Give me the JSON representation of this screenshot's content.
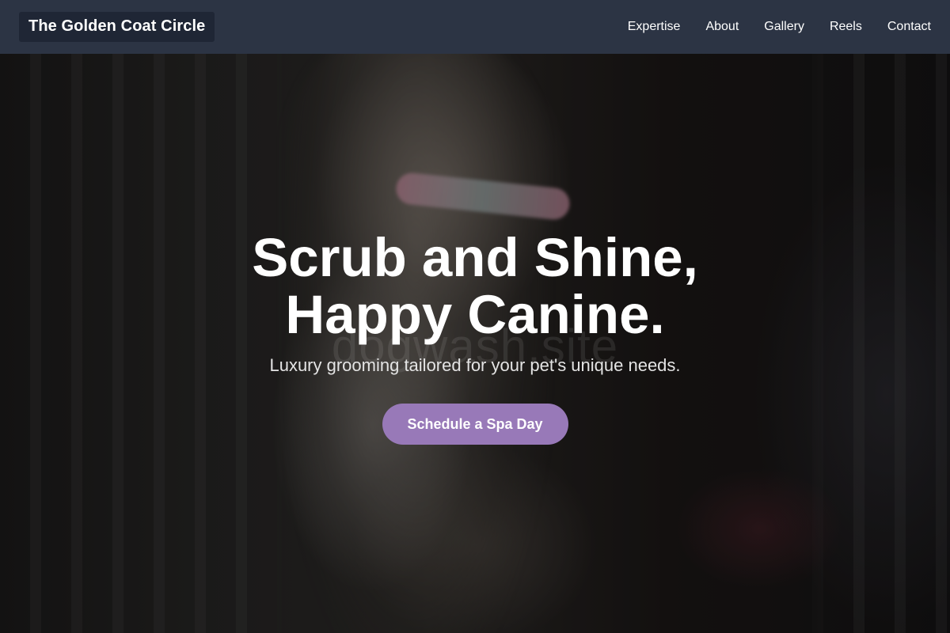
{
  "nav": {
    "brand": "The Golden Coat Circle",
    "links": [
      "Expertise",
      "About",
      "Gallery",
      "Reels",
      "Contact"
    ]
  },
  "hero": {
    "title_line1": "Scrub and Shine,",
    "title_line2": "Happy Canine.",
    "subtitle": "Luxury grooming tailored for your pet's unique needs.",
    "cta_label": "Schedule a Spa Day",
    "watermark": "dogwash.site",
    "background_image": "blurred-cat-in-cage-photo"
  },
  "colors": {
    "navbar_bg": "#2c3444",
    "brand_bg": "#1f2635",
    "cta_bg": "#9879b8",
    "text": "#ffffff"
  }
}
